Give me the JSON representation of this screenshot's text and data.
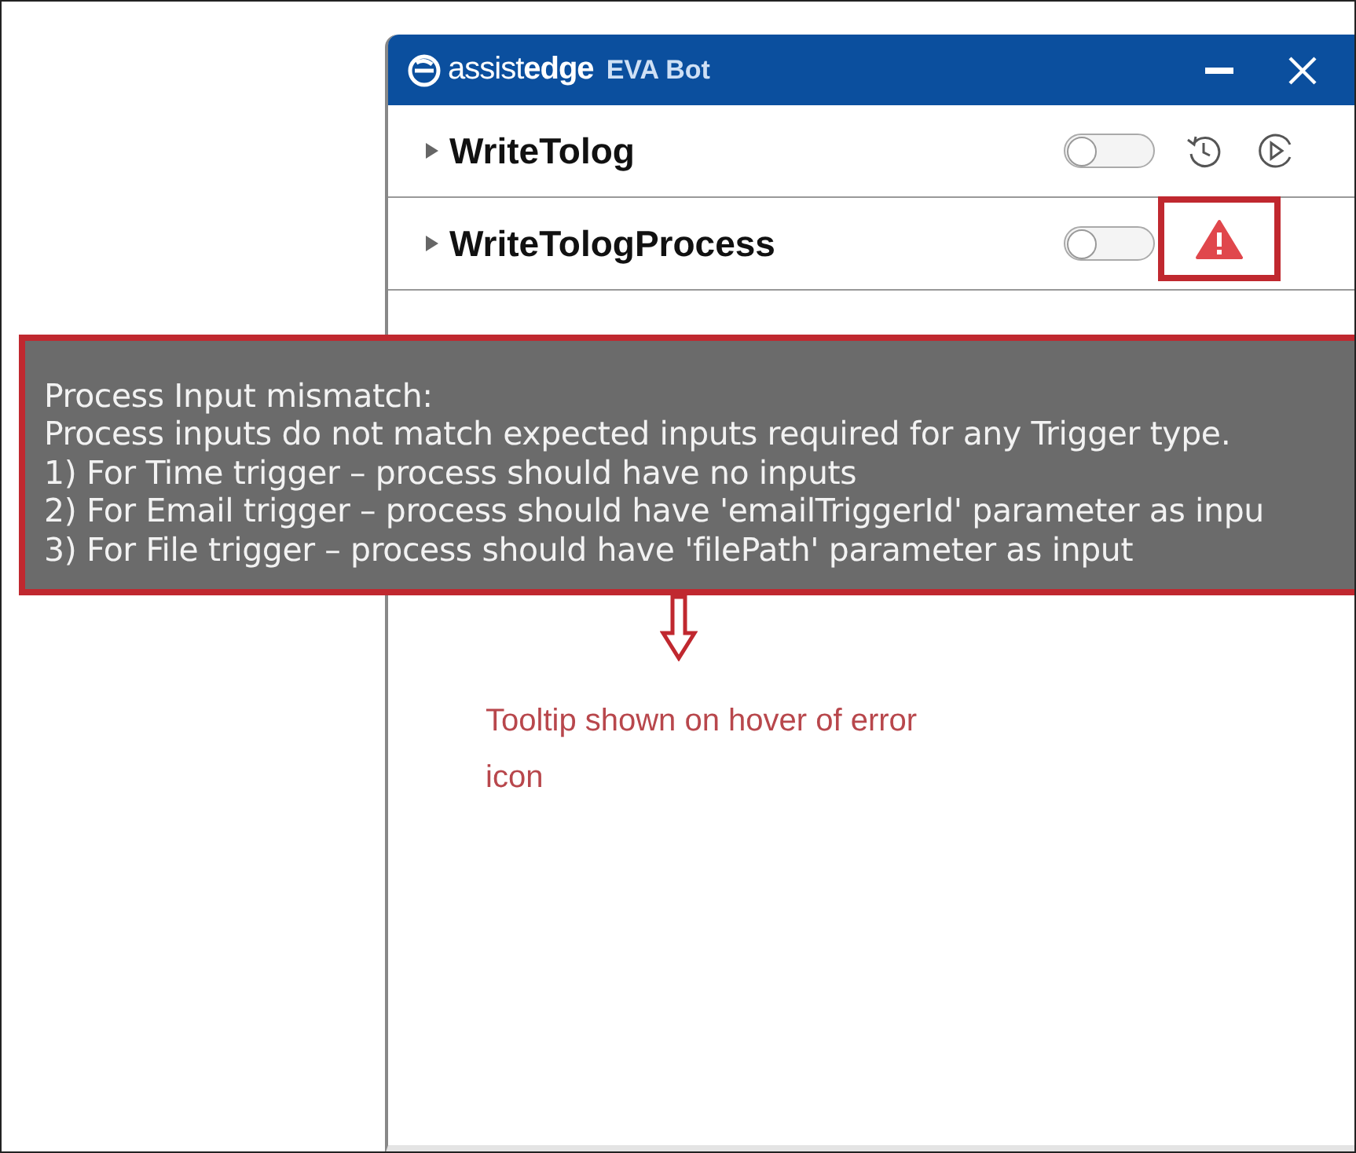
{
  "window": {
    "brand": "assist**edge**",
    "title": "EVA Bot"
  },
  "processes": [
    {
      "name": "WriteTolog",
      "expanded": false,
      "on": false,
      "kind": "ok",
      "highlighted": false
    },
    {
      "name": "WriteTologProcess",
      "expanded": false,
      "on": false,
      "kind": "error",
      "highlighted": true
    }
  ],
  "tooltip": {
    "lines": [
      "Process Input mismatch:",
      "Process inputs do not match expected inputs required for any Trigger type.",
      "1) For Time trigger – process should have no inputs",
      "2) For Email trigger – process should have 'emailTriggerId' parameter as inpu",
      "3) For File trigger – process should have 'filePath' parameter as input"
    ]
  },
  "annotation": {
    "text": "Tooltip shown on hover of error icon"
  }
}
